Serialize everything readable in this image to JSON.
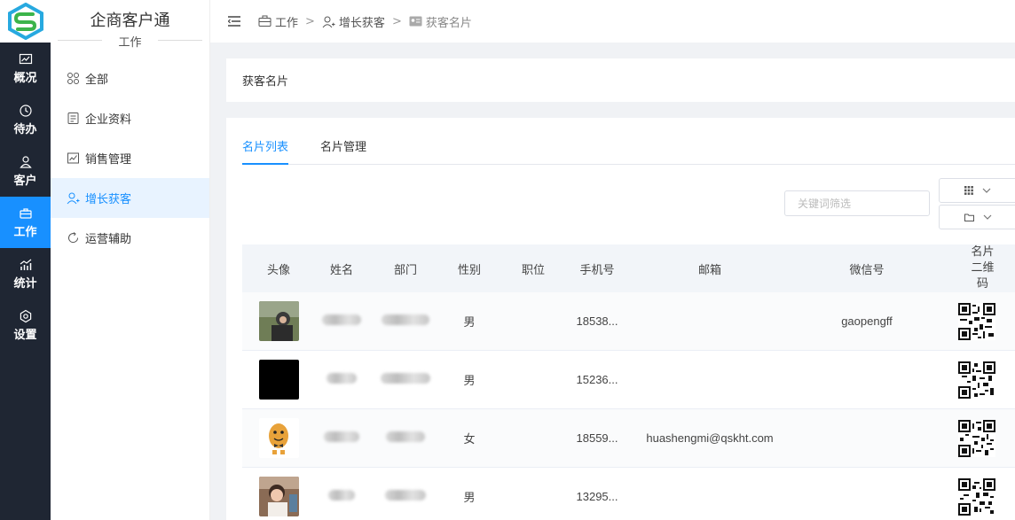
{
  "app": {
    "title": "企商客户通",
    "section": "工作"
  },
  "rail": [
    {
      "label": "概况",
      "icon": "chart-icon"
    },
    {
      "label": "待办",
      "icon": "clock-icon"
    },
    {
      "label": "客户",
      "icon": "user-icon"
    },
    {
      "label": "工作",
      "icon": "briefcase-icon",
      "active": true
    },
    {
      "label": "统计",
      "icon": "bars-icon"
    },
    {
      "label": "设置",
      "icon": "gear-icon"
    }
  ],
  "menu": [
    {
      "label": "全部",
      "icon": "grid-icon"
    },
    {
      "label": "企业资料",
      "icon": "document-icon"
    },
    {
      "label": "销售管理",
      "icon": "sales-chart-icon"
    },
    {
      "label": "增长获客",
      "icon": "user-plus-icon",
      "active": true
    },
    {
      "label": "运营辅助",
      "icon": "refresh-icon"
    }
  ],
  "breadcrumb": {
    "items": [
      "工作",
      "增长获客",
      "获客名片"
    ],
    "separator": ">"
  },
  "page_title": "获客名片",
  "tabs": [
    {
      "label": "名片列表",
      "active": true
    },
    {
      "label": "名片管理"
    }
  ],
  "search": {
    "placeholder": "关键词筛选"
  },
  "table": {
    "headers": [
      "头像",
      "姓名",
      "部门",
      "性别",
      "职位",
      "手机号",
      "邮箱",
      "微信号",
      "名片二维码"
    ],
    "rows": [
      {
        "gender": "男",
        "position": "",
        "phone": "18538...",
        "email": "",
        "wechat": "gaopengff"
      },
      {
        "gender": "男",
        "position": "",
        "phone": "15236...",
        "email": "",
        "wechat": ""
      },
      {
        "gender": "女",
        "position": "",
        "phone": "18559...",
        "email": "huashengmi@qskht.com",
        "wechat": ""
      },
      {
        "gender": "男",
        "position": "",
        "phone": "13295...",
        "email": "",
        "wechat": ""
      }
    ]
  },
  "colors": {
    "accent": "#1890ff",
    "rail_bg": "#1f2633",
    "active_menu_bg": "#e8f3ff"
  }
}
